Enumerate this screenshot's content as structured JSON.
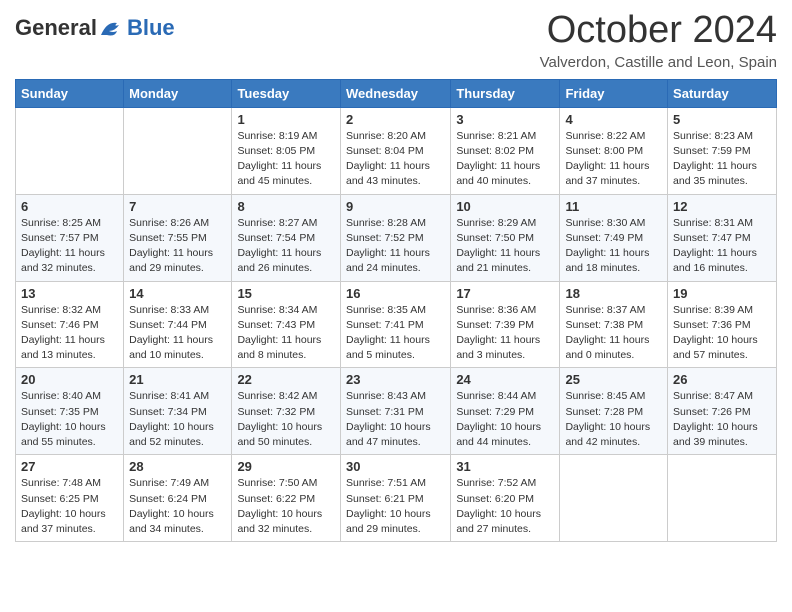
{
  "header": {
    "logo_general": "General",
    "logo_blue": "Blue",
    "month_title": "October 2024",
    "location": "Valverdon, Castille and Leon, Spain"
  },
  "days_of_week": [
    "Sunday",
    "Monday",
    "Tuesday",
    "Wednesday",
    "Thursday",
    "Friday",
    "Saturday"
  ],
  "weeks": [
    [
      {
        "num": "",
        "sunrise": "",
        "sunset": "",
        "daylight": ""
      },
      {
        "num": "",
        "sunrise": "",
        "sunset": "",
        "daylight": ""
      },
      {
        "num": "1",
        "sunrise": "Sunrise: 8:19 AM",
        "sunset": "Sunset: 8:05 PM",
        "daylight": "Daylight: 11 hours and 45 minutes."
      },
      {
        "num": "2",
        "sunrise": "Sunrise: 8:20 AM",
        "sunset": "Sunset: 8:04 PM",
        "daylight": "Daylight: 11 hours and 43 minutes."
      },
      {
        "num": "3",
        "sunrise": "Sunrise: 8:21 AM",
        "sunset": "Sunset: 8:02 PM",
        "daylight": "Daylight: 11 hours and 40 minutes."
      },
      {
        "num": "4",
        "sunrise": "Sunrise: 8:22 AM",
        "sunset": "Sunset: 8:00 PM",
        "daylight": "Daylight: 11 hours and 37 minutes."
      },
      {
        "num": "5",
        "sunrise": "Sunrise: 8:23 AM",
        "sunset": "Sunset: 7:59 PM",
        "daylight": "Daylight: 11 hours and 35 minutes."
      }
    ],
    [
      {
        "num": "6",
        "sunrise": "Sunrise: 8:25 AM",
        "sunset": "Sunset: 7:57 PM",
        "daylight": "Daylight: 11 hours and 32 minutes."
      },
      {
        "num": "7",
        "sunrise": "Sunrise: 8:26 AM",
        "sunset": "Sunset: 7:55 PM",
        "daylight": "Daylight: 11 hours and 29 minutes."
      },
      {
        "num": "8",
        "sunrise": "Sunrise: 8:27 AM",
        "sunset": "Sunset: 7:54 PM",
        "daylight": "Daylight: 11 hours and 26 minutes."
      },
      {
        "num": "9",
        "sunrise": "Sunrise: 8:28 AM",
        "sunset": "Sunset: 7:52 PM",
        "daylight": "Daylight: 11 hours and 24 minutes."
      },
      {
        "num": "10",
        "sunrise": "Sunrise: 8:29 AM",
        "sunset": "Sunset: 7:50 PM",
        "daylight": "Daylight: 11 hours and 21 minutes."
      },
      {
        "num": "11",
        "sunrise": "Sunrise: 8:30 AM",
        "sunset": "Sunset: 7:49 PM",
        "daylight": "Daylight: 11 hours and 18 minutes."
      },
      {
        "num": "12",
        "sunrise": "Sunrise: 8:31 AM",
        "sunset": "Sunset: 7:47 PM",
        "daylight": "Daylight: 11 hours and 16 minutes."
      }
    ],
    [
      {
        "num": "13",
        "sunrise": "Sunrise: 8:32 AM",
        "sunset": "Sunset: 7:46 PM",
        "daylight": "Daylight: 11 hours and 13 minutes."
      },
      {
        "num": "14",
        "sunrise": "Sunrise: 8:33 AM",
        "sunset": "Sunset: 7:44 PM",
        "daylight": "Daylight: 11 hours and 10 minutes."
      },
      {
        "num": "15",
        "sunrise": "Sunrise: 8:34 AM",
        "sunset": "Sunset: 7:43 PM",
        "daylight": "Daylight: 11 hours and 8 minutes."
      },
      {
        "num": "16",
        "sunrise": "Sunrise: 8:35 AM",
        "sunset": "Sunset: 7:41 PM",
        "daylight": "Daylight: 11 hours and 5 minutes."
      },
      {
        "num": "17",
        "sunrise": "Sunrise: 8:36 AM",
        "sunset": "Sunset: 7:39 PM",
        "daylight": "Daylight: 11 hours and 3 minutes."
      },
      {
        "num": "18",
        "sunrise": "Sunrise: 8:37 AM",
        "sunset": "Sunset: 7:38 PM",
        "daylight": "Daylight: 11 hours and 0 minutes."
      },
      {
        "num": "19",
        "sunrise": "Sunrise: 8:39 AM",
        "sunset": "Sunset: 7:36 PM",
        "daylight": "Daylight: 10 hours and 57 minutes."
      }
    ],
    [
      {
        "num": "20",
        "sunrise": "Sunrise: 8:40 AM",
        "sunset": "Sunset: 7:35 PM",
        "daylight": "Daylight: 10 hours and 55 minutes."
      },
      {
        "num": "21",
        "sunrise": "Sunrise: 8:41 AM",
        "sunset": "Sunset: 7:34 PM",
        "daylight": "Daylight: 10 hours and 52 minutes."
      },
      {
        "num": "22",
        "sunrise": "Sunrise: 8:42 AM",
        "sunset": "Sunset: 7:32 PM",
        "daylight": "Daylight: 10 hours and 50 minutes."
      },
      {
        "num": "23",
        "sunrise": "Sunrise: 8:43 AM",
        "sunset": "Sunset: 7:31 PM",
        "daylight": "Daylight: 10 hours and 47 minutes."
      },
      {
        "num": "24",
        "sunrise": "Sunrise: 8:44 AM",
        "sunset": "Sunset: 7:29 PM",
        "daylight": "Daylight: 10 hours and 44 minutes."
      },
      {
        "num": "25",
        "sunrise": "Sunrise: 8:45 AM",
        "sunset": "Sunset: 7:28 PM",
        "daylight": "Daylight: 10 hours and 42 minutes."
      },
      {
        "num": "26",
        "sunrise": "Sunrise: 8:47 AM",
        "sunset": "Sunset: 7:26 PM",
        "daylight": "Daylight: 10 hours and 39 minutes."
      }
    ],
    [
      {
        "num": "27",
        "sunrise": "Sunrise: 7:48 AM",
        "sunset": "Sunset: 6:25 PM",
        "daylight": "Daylight: 10 hours and 37 minutes."
      },
      {
        "num": "28",
        "sunrise": "Sunrise: 7:49 AM",
        "sunset": "Sunset: 6:24 PM",
        "daylight": "Daylight: 10 hours and 34 minutes."
      },
      {
        "num": "29",
        "sunrise": "Sunrise: 7:50 AM",
        "sunset": "Sunset: 6:22 PM",
        "daylight": "Daylight: 10 hours and 32 minutes."
      },
      {
        "num": "30",
        "sunrise": "Sunrise: 7:51 AM",
        "sunset": "Sunset: 6:21 PM",
        "daylight": "Daylight: 10 hours and 29 minutes."
      },
      {
        "num": "31",
        "sunrise": "Sunrise: 7:52 AM",
        "sunset": "Sunset: 6:20 PM",
        "daylight": "Daylight: 10 hours and 27 minutes."
      },
      {
        "num": "",
        "sunrise": "",
        "sunset": "",
        "daylight": ""
      },
      {
        "num": "",
        "sunrise": "",
        "sunset": "",
        "daylight": ""
      }
    ]
  ]
}
